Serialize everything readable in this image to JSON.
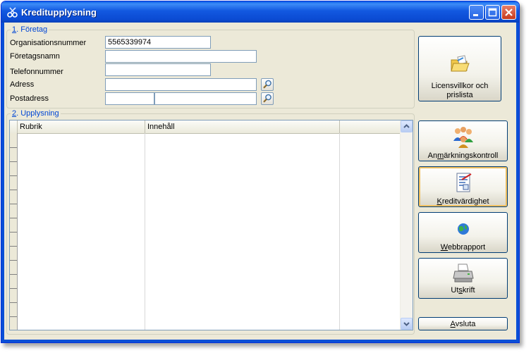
{
  "window": {
    "title": "Kreditupplysning"
  },
  "section1": {
    "legend_prefix": "1",
    "legend_rest": ". Företag",
    "fields": {
      "orgnr_label": "Organisationsnummer",
      "orgnr_value": "5565339974",
      "name_label": "Företagsnamn",
      "name_value": "",
      "phone_label": "Telefonnummer",
      "phone_value": "",
      "address_label": "Adress",
      "address_value": "",
      "postal_label": "Postadress",
      "postal_code_value": "",
      "postal_city_value": ""
    }
  },
  "section2": {
    "legend_prefix": "2",
    "legend_rest": ". Upplysning",
    "table": {
      "columns": [
        "Rubrik",
        "Innehåll",
        ""
      ],
      "rows": []
    }
  },
  "buttons": {
    "license": "Licensvillkor och prislista",
    "remark_pre": "An",
    "remark_mn": "m",
    "remark_post": "ärkningskontroll",
    "credit_mn": "K",
    "credit_post": "reditvärdighet",
    "web_mn": "W",
    "web_post": "ebbrapport",
    "print_pre": "Ut",
    "print_mn": "s",
    "print_post": "krift",
    "exit_mn": "A",
    "exit_post": "vsluta"
  },
  "icons": {
    "app": "scissors-icon",
    "license": "folder-open-icon",
    "remark": "people-group-icon",
    "credit": "document-check-icon",
    "web": "globe-icon",
    "print": "printer-icon",
    "lookup": "magnifier-icon"
  },
  "colors": {
    "titlebar": "#0a4fd6",
    "window_bg": "#ece9d8",
    "legend_text": "#0046d5",
    "close_button": "#c7391c"
  }
}
